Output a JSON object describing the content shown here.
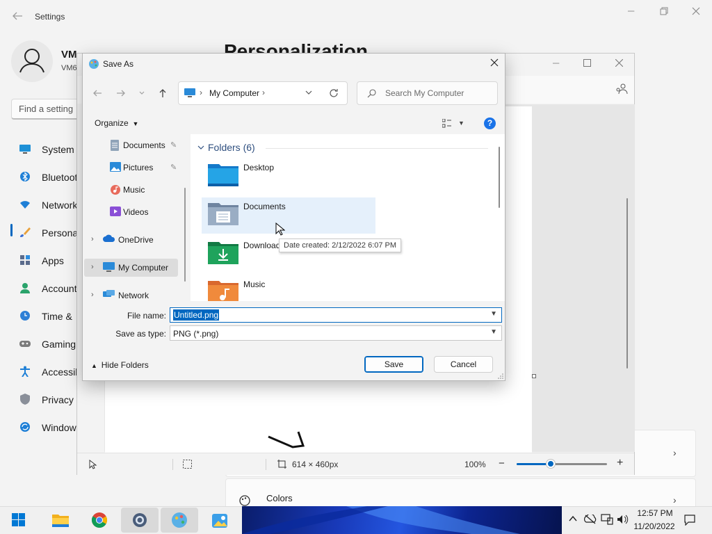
{
  "settings": {
    "title": "Settings",
    "user_name": "VM",
    "user_sub": "VM6",
    "search_placeholder": "Find a setting",
    "page_title": "Personalization",
    "nav": [
      {
        "label": "System",
        "icon": "monitor-icon"
      },
      {
        "label": "Bluetooth",
        "icon": "bluetooth-icon"
      },
      {
        "label": "Network",
        "icon": "wifi-icon"
      },
      {
        "label": "Personalization",
        "icon": "brush-icon"
      },
      {
        "label": "Apps",
        "icon": "apps-icon"
      },
      {
        "label": "Accounts",
        "icon": "person-icon"
      },
      {
        "label": "Time &",
        "icon": "clock-icon"
      },
      {
        "label": "Gaming",
        "icon": "gamepad-icon"
      },
      {
        "label": "Accessibility",
        "icon": "accessibility-icon"
      },
      {
        "label": "Privacy",
        "icon": "shield-icon"
      },
      {
        "label": "Windows",
        "icon": "update-icon"
      }
    ],
    "active_nav_index": 3,
    "colors_label": "Colors"
  },
  "paint": {
    "canvas_size": "614 × 460px",
    "zoom": "100%",
    "zoom_fraction": 0.38
  },
  "dialog": {
    "title": "Save As",
    "address_root": "My Computer",
    "search_placeholder": "Search My Computer",
    "organize_label": "Organize",
    "help_label": "?",
    "nav_items": [
      {
        "label": "Documents",
        "icon": "documents-icon",
        "pinned": true
      },
      {
        "label": "Pictures",
        "icon": "pictures-icon",
        "pinned": true
      },
      {
        "label": "Music",
        "icon": "music-icon",
        "pinned": false
      },
      {
        "label": "Videos",
        "icon": "videos-icon",
        "pinned": false
      },
      {
        "label": "OneDrive",
        "icon": "onedrive-icon",
        "expandable": true
      },
      {
        "label": "My Computer",
        "icon": "computer-icon",
        "expandable": true,
        "selected": true
      },
      {
        "label": "Network",
        "icon": "network-icon",
        "expandable": true
      }
    ],
    "group_header": "Folders (6)",
    "folders": [
      {
        "label": "Desktop",
        "icon": "desktop-folder-icon"
      },
      {
        "label": "Documents",
        "icon": "documents-folder-icon"
      },
      {
        "label": "Downloads",
        "icon": "downloads-folder-icon"
      },
      {
        "label": "Music",
        "icon": "music-folder-icon"
      }
    ],
    "tooltip": "Date created: 2/12/2022 6:07 PM",
    "file_name_label": "File name:",
    "file_name_value": "Untitled.png",
    "save_type_label": "Save as type:",
    "save_type_value": "PNG (*.png)",
    "hide_folders_label": "Hide Folders",
    "save_label": "Save",
    "cancel_label": "Cancel"
  },
  "taskbar": {
    "apps": [
      "start-icon",
      "file-explorer-icon",
      "chrome-icon",
      "settings-gear-icon",
      "paint-icon",
      "photos-icon"
    ],
    "time": "12:57 PM",
    "date": "11/20/2022"
  },
  "colors": {
    "accent": "#0067c0",
    "folder_blue": "#1e88d8",
    "folder_green": "#1fa35c",
    "folder_orange": "#f08a3c"
  }
}
